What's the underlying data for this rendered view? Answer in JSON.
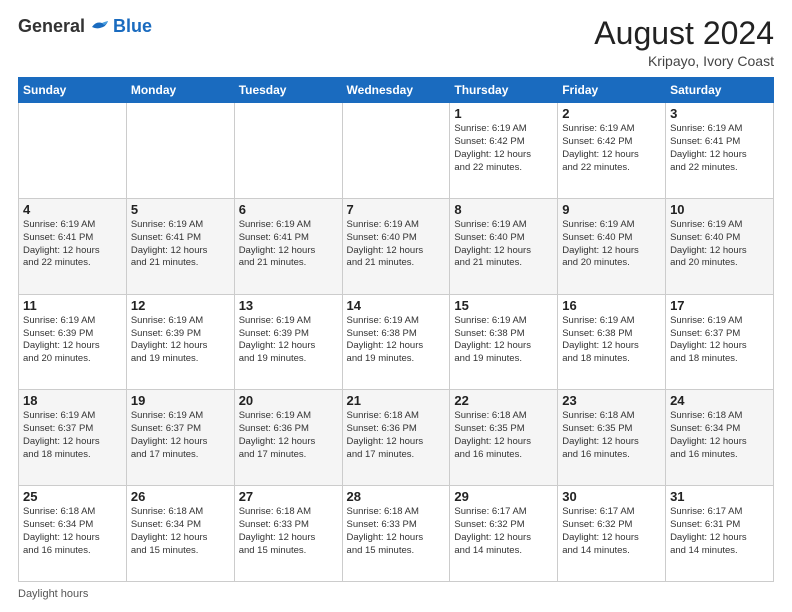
{
  "header": {
    "logo_general": "General",
    "logo_blue": "Blue",
    "month_year": "August 2024",
    "location": "Kripayo, Ivory Coast"
  },
  "footer": {
    "label": "Daylight hours"
  },
  "days_of_week": [
    "Sunday",
    "Monday",
    "Tuesday",
    "Wednesday",
    "Thursday",
    "Friday",
    "Saturday"
  ],
  "weeks": [
    [
      {
        "day": "",
        "info": ""
      },
      {
        "day": "",
        "info": ""
      },
      {
        "day": "",
        "info": ""
      },
      {
        "day": "",
        "info": ""
      },
      {
        "day": "1",
        "info": "Sunrise: 6:19 AM\nSunset: 6:42 PM\nDaylight: 12 hours\nand 22 minutes."
      },
      {
        "day": "2",
        "info": "Sunrise: 6:19 AM\nSunset: 6:42 PM\nDaylight: 12 hours\nand 22 minutes."
      },
      {
        "day": "3",
        "info": "Sunrise: 6:19 AM\nSunset: 6:41 PM\nDaylight: 12 hours\nand 22 minutes."
      }
    ],
    [
      {
        "day": "4",
        "info": "Sunrise: 6:19 AM\nSunset: 6:41 PM\nDaylight: 12 hours\nand 22 minutes."
      },
      {
        "day": "5",
        "info": "Sunrise: 6:19 AM\nSunset: 6:41 PM\nDaylight: 12 hours\nand 21 minutes."
      },
      {
        "day": "6",
        "info": "Sunrise: 6:19 AM\nSunset: 6:41 PM\nDaylight: 12 hours\nand 21 minutes."
      },
      {
        "day": "7",
        "info": "Sunrise: 6:19 AM\nSunset: 6:40 PM\nDaylight: 12 hours\nand 21 minutes."
      },
      {
        "day": "8",
        "info": "Sunrise: 6:19 AM\nSunset: 6:40 PM\nDaylight: 12 hours\nand 21 minutes."
      },
      {
        "day": "9",
        "info": "Sunrise: 6:19 AM\nSunset: 6:40 PM\nDaylight: 12 hours\nand 20 minutes."
      },
      {
        "day": "10",
        "info": "Sunrise: 6:19 AM\nSunset: 6:40 PM\nDaylight: 12 hours\nand 20 minutes."
      }
    ],
    [
      {
        "day": "11",
        "info": "Sunrise: 6:19 AM\nSunset: 6:39 PM\nDaylight: 12 hours\nand 20 minutes."
      },
      {
        "day": "12",
        "info": "Sunrise: 6:19 AM\nSunset: 6:39 PM\nDaylight: 12 hours\nand 19 minutes."
      },
      {
        "day": "13",
        "info": "Sunrise: 6:19 AM\nSunset: 6:39 PM\nDaylight: 12 hours\nand 19 minutes."
      },
      {
        "day": "14",
        "info": "Sunrise: 6:19 AM\nSunset: 6:38 PM\nDaylight: 12 hours\nand 19 minutes."
      },
      {
        "day": "15",
        "info": "Sunrise: 6:19 AM\nSunset: 6:38 PM\nDaylight: 12 hours\nand 19 minutes."
      },
      {
        "day": "16",
        "info": "Sunrise: 6:19 AM\nSunset: 6:38 PM\nDaylight: 12 hours\nand 18 minutes."
      },
      {
        "day": "17",
        "info": "Sunrise: 6:19 AM\nSunset: 6:37 PM\nDaylight: 12 hours\nand 18 minutes."
      }
    ],
    [
      {
        "day": "18",
        "info": "Sunrise: 6:19 AM\nSunset: 6:37 PM\nDaylight: 12 hours\nand 18 minutes."
      },
      {
        "day": "19",
        "info": "Sunrise: 6:19 AM\nSunset: 6:37 PM\nDaylight: 12 hours\nand 17 minutes."
      },
      {
        "day": "20",
        "info": "Sunrise: 6:19 AM\nSunset: 6:36 PM\nDaylight: 12 hours\nand 17 minutes."
      },
      {
        "day": "21",
        "info": "Sunrise: 6:18 AM\nSunset: 6:36 PM\nDaylight: 12 hours\nand 17 minutes."
      },
      {
        "day": "22",
        "info": "Sunrise: 6:18 AM\nSunset: 6:35 PM\nDaylight: 12 hours\nand 16 minutes."
      },
      {
        "day": "23",
        "info": "Sunrise: 6:18 AM\nSunset: 6:35 PM\nDaylight: 12 hours\nand 16 minutes."
      },
      {
        "day": "24",
        "info": "Sunrise: 6:18 AM\nSunset: 6:34 PM\nDaylight: 12 hours\nand 16 minutes."
      }
    ],
    [
      {
        "day": "25",
        "info": "Sunrise: 6:18 AM\nSunset: 6:34 PM\nDaylight: 12 hours\nand 16 minutes."
      },
      {
        "day": "26",
        "info": "Sunrise: 6:18 AM\nSunset: 6:34 PM\nDaylight: 12 hours\nand 15 minutes."
      },
      {
        "day": "27",
        "info": "Sunrise: 6:18 AM\nSunset: 6:33 PM\nDaylight: 12 hours\nand 15 minutes."
      },
      {
        "day": "28",
        "info": "Sunrise: 6:18 AM\nSunset: 6:33 PM\nDaylight: 12 hours\nand 15 minutes."
      },
      {
        "day": "29",
        "info": "Sunrise: 6:17 AM\nSunset: 6:32 PM\nDaylight: 12 hours\nand 14 minutes."
      },
      {
        "day": "30",
        "info": "Sunrise: 6:17 AM\nSunset: 6:32 PM\nDaylight: 12 hours\nand 14 minutes."
      },
      {
        "day": "31",
        "info": "Sunrise: 6:17 AM\nSunset: 6:31 PM\nDaylight: 12 hours\nand 14 minutes."
      }
    ]
  ]
}
